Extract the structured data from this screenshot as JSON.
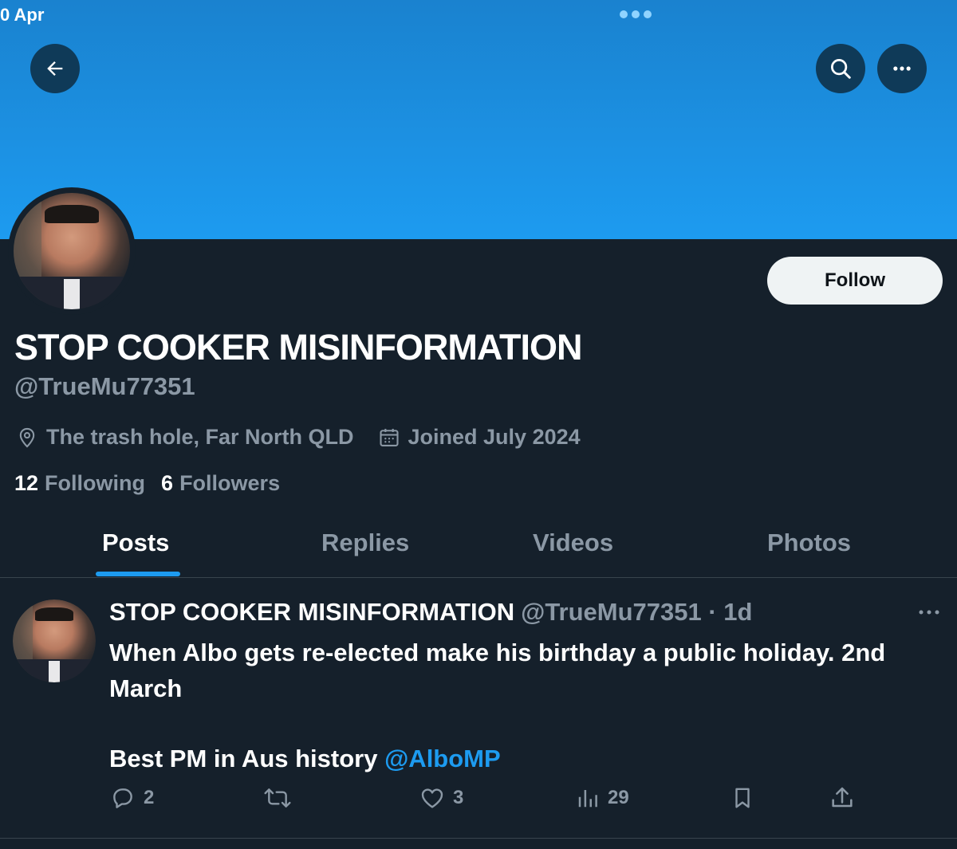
{
  "status_bar": {
    "date": "0 Apr"
  },
  "profile": {
    "display_name": "STOP COOKER MISINFORMATION",
    "handle": "@TrueMu77351",
    "location": "The trash hole, Far North QLD",
    "joined": "Joined July 2024",
    "following_count": "12",
    "following_label": "Following",
    "followers_count": "6",
    "followers_label": "Followers",
    "follow_button": "Follow"
  },
  "tabs": [
    {
      "label": "Posts",
      "active": true
    },
    {
      "label": "Replies",
      "active": false
    },
    {
      "label": "Videos",
      "active": false
    },
    {
      "label": "Photos",
      "active": false
    }
  ],
  "tweet": {
    "author_name": "STOP COOKER MISINFORMATION",
    "author_handle_time": "@TrueMu77351 · 1d",
    "text_line_1": "When Albo gets re-elected make his birthday a public holiday. 2nd March",
    "text_line_2": "Best PM in Aus history ",
    "mention": "@AlboMP",
    "replies": "2",
    "likes": "3",
    "views": "29"
  },
  "icons": {
    "back": "arrow-left-icon",
    "search": "search-icon",
    "more": "more-horizontal-icon",
    "location": "location-pin-icon",
    "calendar": "calendar-icon",
    "reply": "reply-icon",
    "retweet": "retweet-icon",
    "like": "heart-icon",
    "views": "views-icon",
    "bookmark": "bookmark-icon",
    "share": "share-icon"
  },
  "colors": {
    "accent": "#1d9bf0",
    "background": "#15202b",
    "secondary_text": "#8b98a5"
  }
}
